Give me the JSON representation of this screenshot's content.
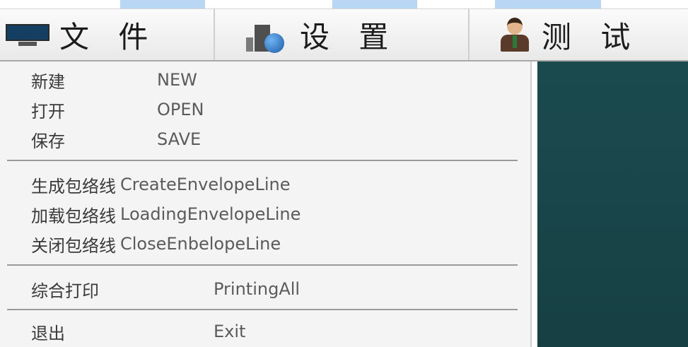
{
  "menubar": {
    "items": [
      {
        "label": "文 件",
        "icon": "monitor-icon"
      },
      {
        "label": "设 置",
        "icon": "settings-icon"
      },
      {
        "label": "测 试",
        "icon": "person-icon"
      }
    ]
  },
  "dropdown": {
    "groups": [
      [
        {
          "cn": "新建",
          "en": "NEW"
        },
        {
          "cn": "打开",
          "en": "OPEN"
        },
        {
          "cn": "保存",
          "en": "SAVE"
        }
      ],
      [
        {
          "cn": "生成包络线",
          "en": "CreateEnvelopeLine"
        },
        {
          "cn": "加载包络线",
          "en": "LoadingEnvelopeLine"
        },
        {
          "cn": "关闭包络线",
          "en": "CloseEnbelopeLine"
        }
      ],
      [
        {
          "cn": "综合打印",
          "en": "PrintingAll"
        }
      ],
      [
        {
          "cn": "退出",
          "en": "Exit"
        }
      ]
    ]
  },
  "colors": {
    "menubar_bg": "#efefef",
    "dropdown_bg": "#f4f4f4",
    "panel_bg": "#1b4a4e"
  }
}
